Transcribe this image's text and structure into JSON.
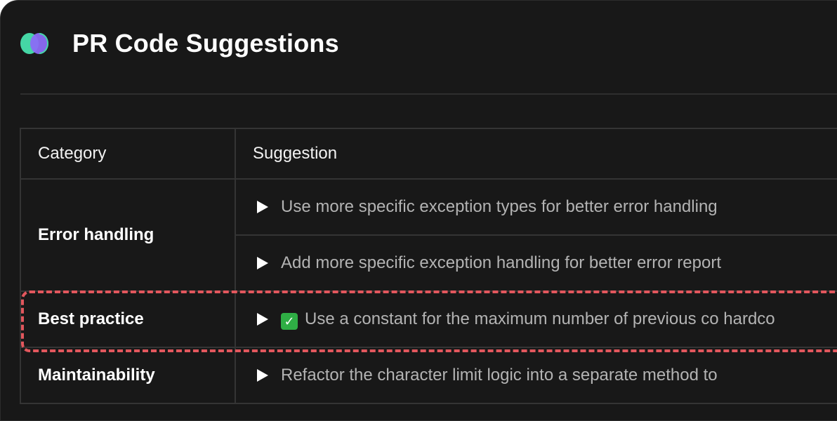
{
  "header": {
    "title": "PR Code Suggestions",
    "logo_icon": "qodo-logo-icon"
  },
  "table": {
    "columns": [
      "Category",
      "Suggestion"
    ],
    "groups": [
      {
        "category": "Error handling",
        "suggestions": [
          "Use more specific exception types for better error handling",
          "Add more specific exception handling for better error report"
        ]
      },
      {
        "category": "Best practice",
        "suggestions": [
          "Use a constant for the maximum number of previous co hardco"
        ],
        "highlighted": true,
        "check_icon": "✓"
      },
      {
        "category": "Maintainability",
        "suggestions": [
          "Refactor the character limit logic into a separate method to"
        ]
      }
    ]
  },
  "colors": {
    "background": "#181818",
    "highlight_border": "#e2575d",
    "logo_green": "#45d6a5",
    "logo_purple": "#8b6cf6",
    "check_green": "#2fae45"
  }
}
